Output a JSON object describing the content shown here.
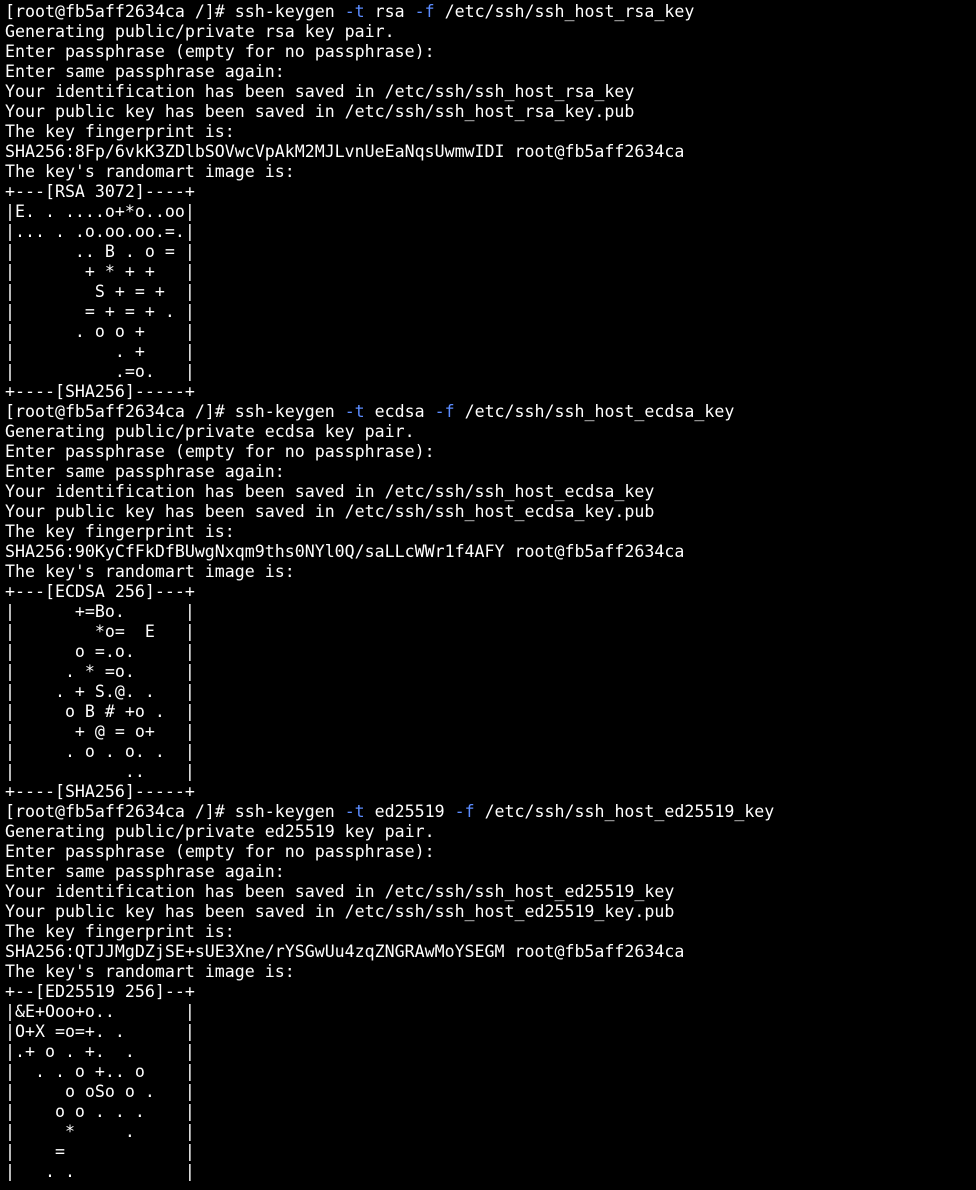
{
  "terminal": {
    "background_color": "#000000",
    "text_color": "#ffffff",
    "flag_color": "#5b8cff",
    "blocks": [
      {
        "command": {
          "prompt": "[root@fb5aff2634ca /]# ",
          "program": "ssh-keygen ",
          "flag_type": "-t",
          "type_value": " rsa ",
          "flag_file": "-f",
          "file_value": " /etc/ssh/ssh_host_rsa_key"
        },
        "output": [
          "Generating public/private rsa key pair.",
          "Enter passphrase (empty for no passphrase):",
          "Enter same passphrase again:",
          "Your identification has been saved in /etc/ssh/ssh_host_rsa_key",
          "Your public key has been saved in /etc/ssh/ssh_host_rsa_key.pub",
          "The key fingerprint is:",
          "SHA256:8Fp/6vkK3ZDlbSOVwcVpAkM2MJLvnUeEaNqsUwmwIDI root@fb5aff2634ca",
          "The key's randomart image is:"
        ],
        "randomart": [
          "+---[RSA 3072]----+",
          "|E. . ....o+*o..oo|",
          "|... . .o.oo.oo.=.|",
          "|      .. B . o = |",
          "|       + * + +   |",
          "|        S + = +  |",
          "|       = + = + . |",
          "|      . o o +    |",
          "|          . +    |",
          "|          .=o.   |",
          "+----[SHA256]-----+"
        ]
      },
      {
        "command": {
          "prompt": "[root@fb5aff2634ca /]# ",
          "program": "ssh-keygen ",
          "flag_type": "-t",
          "type_value": " ecdsa ",
          "flag_file": "-f",
          "file_value": " /etc/ssh/ssh_host_ecdsa_key"
        },
        "output": [
          "Generating public/private ecdsa key pair.",
          "Enter passphrase (empty for no passphrase):",
          "Enter same passphrase again:",
          "Your identification has been saved in /etc/ssh/ssh_host_ecdsa_key",
          "Your public key has been saved in /etc/ssh/ssh_host_ecdsa_key.pub",
          "The key fingerprint is:",
          "SHA256:90KyCfFkDfBUwgNxqm9ths0NYl0Q/saLLcWWr1f4AFY root@fb5aff2634ca",
          "The key's randomart image is:"
        ],
        "randomart": [
          "+---[ECDSA 256]---+",
          "|      +=Bo.      |",
          "|        *o=  E   |",
          "|      o =.o.     |",
          "|     . * =o.     |",
          "|    . + S.@. .   |",
          "|     o B # +o .  |",
          "|      + @ = o+   |",
          "|     . o . o. .  |",
          "|           ..    |",
          "+----[SHA256]-----+"
        ]
      },
      {
        "command": {
          "prompt": "[root@fb5aff2634ca /]# ",
          "program": "ssh-keygen ",
          "flag_type": "-t",
          "type_value": " ed25519 ",
          "flag_file": "-f",
          "file_value": " /etc/ssh/ssh_host_ed25519_key"
        },
        "output": [
          "Generating public/private ed25519 key pair.",
          "Enter passphrase (empty for no passphrase):",
          "Enter same passphrase again:",
          "Your identification has been saved in /etc/ssh/ssh_host_ed25519_key",
          "Your public key has been saved in /etc/ssh/ssh_host_ed25519_key.pub",
          "The key fingerprint is:",
          "SHA256:QTJJMgDZjSE+sUE3Xne/rYSGwUu4zqZNGRAwMoYSEGM root@fb5aff2634ca",
          "The key's randomart image is:"
        ],
        "randomart": [
          "+--[ED25519 256]--+",
          "|&E+Ooo+o..       |",
          "|O+X =o=+. .      |",
          "|.+ o . +.  .     |",
          "|  . . o +.. o    |",
          "|     o oSo o .   |",
          "|    o o . . .    |",
          "|     *     .     |",
          "|    =            |",
          "|   . .           |"
        ]
      }
    ]
  }
}
